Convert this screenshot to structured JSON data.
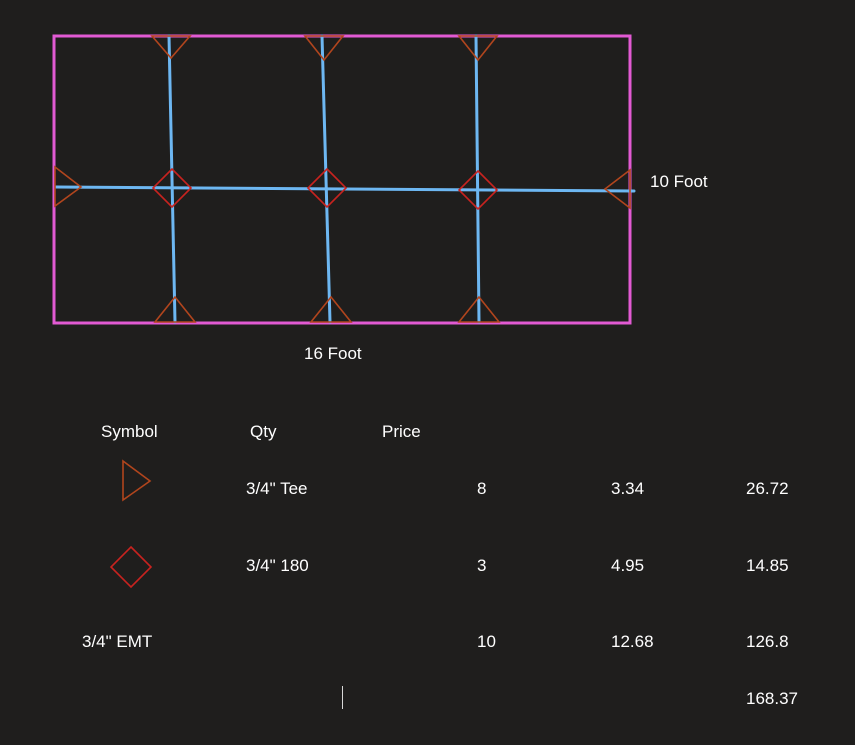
{
  "colors": {
    "background": "#1f1e1d",
    "outline": "#e25ad3",
    "pipe": "#6db7f2",
    "tee_symbol": "#b1451d",
    "elbow_symbol": "#c8231f",
    "text": "#ffffff"
  },
  "diagram": {
    "width_label": "16 Foot",
    "height_label": "10 Foot"
  },
  "table": {
    "headers": {
      "symbol": "Symbol",
      "qty": "Qty",
      "price": "Price"
    },
    "rows": [
      {
        "symbol_icon": "tee-triangle-icon",
        "item": "3/4\" Tee",
        "qty": "8",
        "price": "3.34",
        "total": "26.72"
      },
      {
        "symbol_icon": "elbow-diamond-icon",
        "item": "3/4\" 180",
        "qty": "3",
        "price": "4.95",
        "total": "14.85"
      },
      {
        "item": "3/4\" EMT",
        "qty": "10",
        "price": "12.68",
        "total": "126.8"
      }
    ],
    "grand_total": "168.37"
  }
}
